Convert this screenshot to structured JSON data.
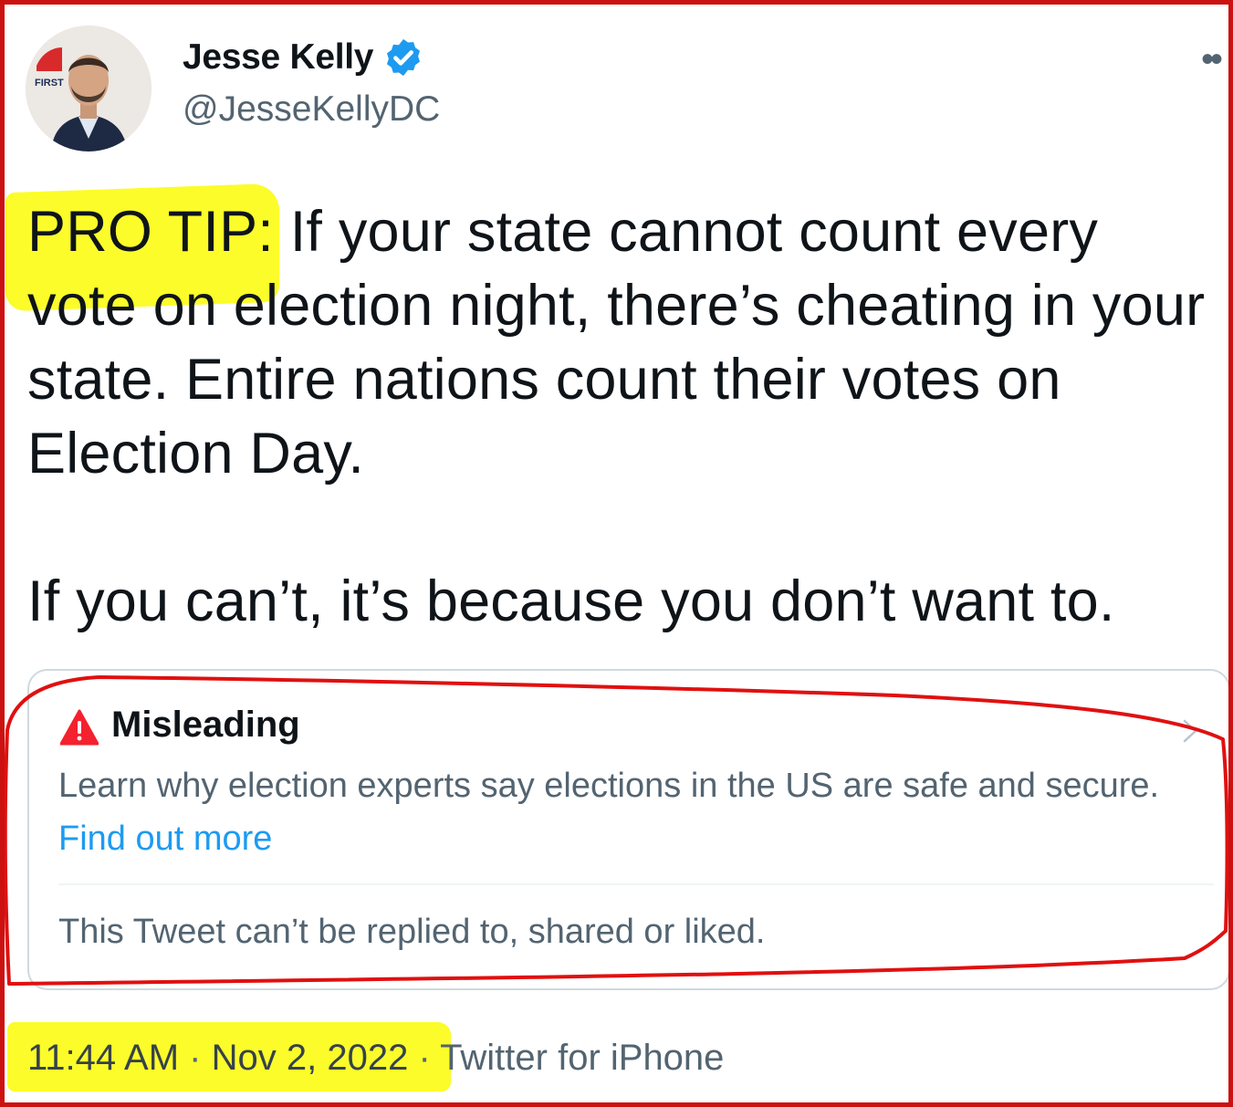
{
  "author": {
    "display_name": "Jesse Kelly",
    "handle": "@JesseKellyDC",
    "avatar_badge_text": "FIRST",
    "verified_icon": "verified-badge-icon"
  },
  "tweet": {
    "pro_tip": "PRO TIP:",
    "paragraph1_rest": " If your state cannot count every vote on election night, there’s cheating in your state. Entire nations count their votes on Election Day.",
    "paragraph2": "If you can’t, it’s because you don’t want to."
  },
  "notice": {
    "title": "Misleading",
    "body": "Learn why election experts say elections in the US are safe and secure.",
    "link_text": "Find out more",
    "restriction": "This Tweet can’t be replied to, shared or liked.",
    "icon": "warning-icon"
  },
  "meta": {
    "time": "11:44 AM",
    "separator": "·",
    "date": "Nov 2, 2022",
    "source": "Twitter for iPhone"
  },
  "colors": {
    "accent": "#1d9bf0",
    "secondary_text": "#536471",
    "highlight": "#fcfc2a",
    "annotation": "#e01010",
    "warning": "#f4212e"
  }
}
